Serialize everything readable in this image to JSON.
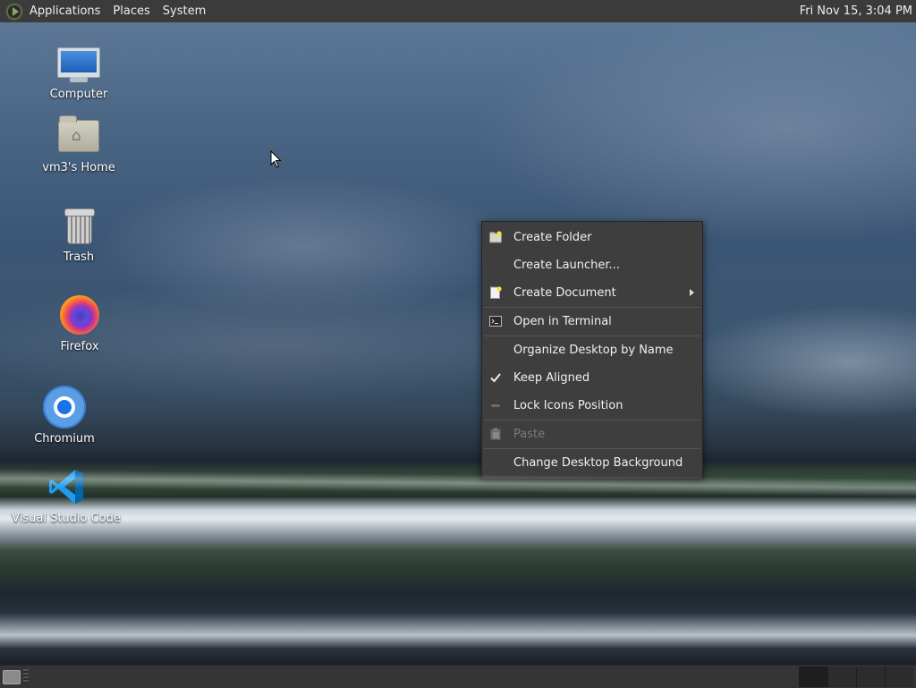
{
  "top_panel": {
    "menus": [
      "Applications",
      "Places",
      "System"
    ],
    "clock": "Fri Nov 15,  3:04 PM"
  },
  "desktop_icons": [
    {
      "label": "Computer",
      "icon": "computer-icon"
    },
    {
      "label": "vm3's Home",
      "icon": "home-folder-icon"
    },
    {
      "label": "Trash",
      "icon": "trash-icon"
    },
    {
      "label": "Firefox",
      "icon": "firefox-icon"
    },
    {
      "label": "Chromium",
      "icon": "chromium-icon"
    },
    {
      "label": "Visual Studio Code",
      "icon": "vscode-icon"
    }
  ],
  "context_menu": {
    "items": [
      {
        "label": "Create Folder",
        "icon": "new-folder-icon"
      },
      {
        "label": "Create Launcher...",
        "icon": ""
      },
      {
        "label": "Create Document",
        "icon": "new-document-icon",
        "submenu": true
      },
      {
        "label": "Open in Terminal",
        "icon": "terminal-icon"
      },
      {
        "label": "Organize Desktop by Name",
        "icon": ""
      },
      {
        "label": "Keep Aligned",
        "icon": "checkmark-icon",
        "checked": true
      },
      {
        "label": "Lock Icons Position",
        "icon": "lock-toggle-icon"
      },
      {
        "label": "Paste",
        "icon": "paste-icon",
        "disabled": true
      },
      {
        "label": "Change Desktop Background",
        "icon": ""
      }
    ]
  },
  "bottom_panel": {
    "workspaces": 4,
    "active_workspace": 1
  },
  "colors": {
    "panel_bg": "#3b3b3b",
    "menu_bg": "#3e3e3e",
    "menu_text": "#f0f0f0",
    "menu_disabled_text": "#7a7a7a"
  }
}
